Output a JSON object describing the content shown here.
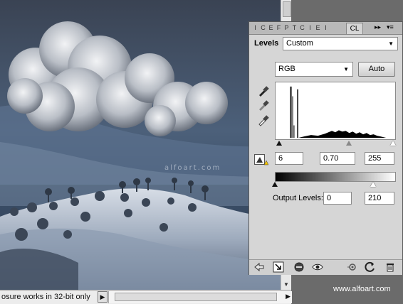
{
  "panel": {
    "mini_tab_glyphs": [
      "I",
      "C",
      "E",
      "F",
      "P",
      "T",
      "C",
      "I",
      "E",
      "I"
    ],
    "active_tab_label": "CL",
    "collapse_glyph": "▸▸",
    "menu_glyph": "▾≡",
    "title": "Levels",
    "preset": "Custom",
    "channel": "RGB",
    "auto_label": "Auto",
    "input_black": "6",
    "input_mid": "0.70",
    "input_white": "255",
    "output_label": "Output Levels:",
    "output_black": "0",
    "output_white": "210"
  },
  "document": {
    "watermark": "alfoart.com",
    "status_text": "osure works in 32-bit only",
    "status_arrow": "▶"
  },
  "credit": "www.alfoart.com",
  "colors": {
    "panel_bg": "#d6d6d6",
    "sky": "#2c3a4f",
    "snow": "#c9d3e0"
  }
}
